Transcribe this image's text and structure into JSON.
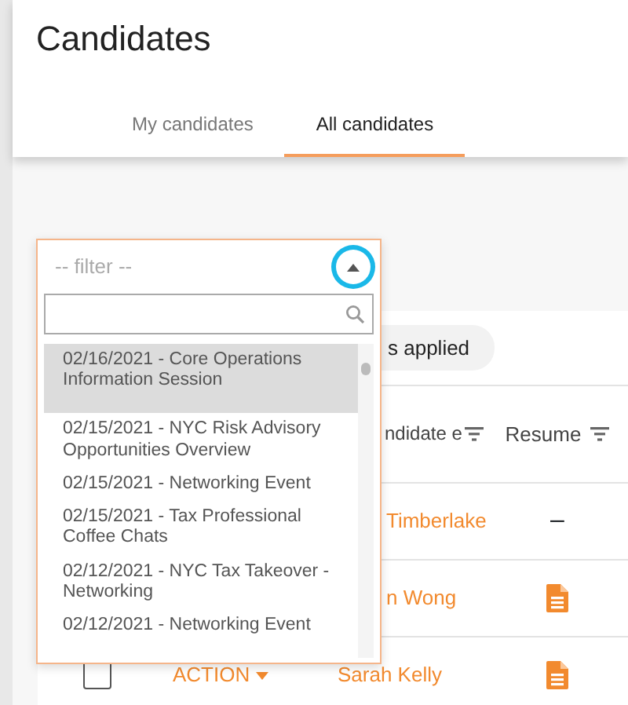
{
  "page": {
    "title": "Candidates"
  },
  "tabs": [
    {
      "label": "My candidates",
      "selected": false
    },
    {
      "label": "All candidates",
      "selected": true
    }
  ],
  "filter_dropdown": {
    "placeholder": "-- filter --",
    "expanded": true,
    "toggle_focused": true,
    "options": [
      {
        "label": "02/16/2021 - Core Operations Information Session",
        "selected": true
      },
      {
        "label": "02/15/2021 - NYC Risk Advisory Opportunities Overview",
        "selected": false
      },
      {
        "label": "02/15/2021 - Networking Event",
        "selected": false
      },
      {
        "label": "02/15/2021 - Tax Professional Coffee Chats",
        "selected": false
      },
      {
        "label": "02/12/2021 - NYC Tax Takeover - Networking",
        "selected": false
      },
      {
        "label": "02/12/2021 - Networking Event",
        "selected": false
      }
    ]
  },
  "filters_chip": "s applied",
  "table": {
    "columns": [
      {
        "label": "ndidate e"
      },
      {
        "label": "Resume"
      }
    ],
    "rows": [
      {
        "covered": true,
        "name": "Timberlake",
        "resume": {
          "kind": "text",
          "text": "–"
        }
      },
      {
        "covered": true,
        "name": "n Wong",
        "resume": {
          "kind": "icon"
        }
      },
      {
        "covered": false,
        "checked": false,
        "action": "ACTION",
        "name": "Sarah Kelly",
        "resume": {
          "kind": "icon"
        }
      }
    ]
  }
}
